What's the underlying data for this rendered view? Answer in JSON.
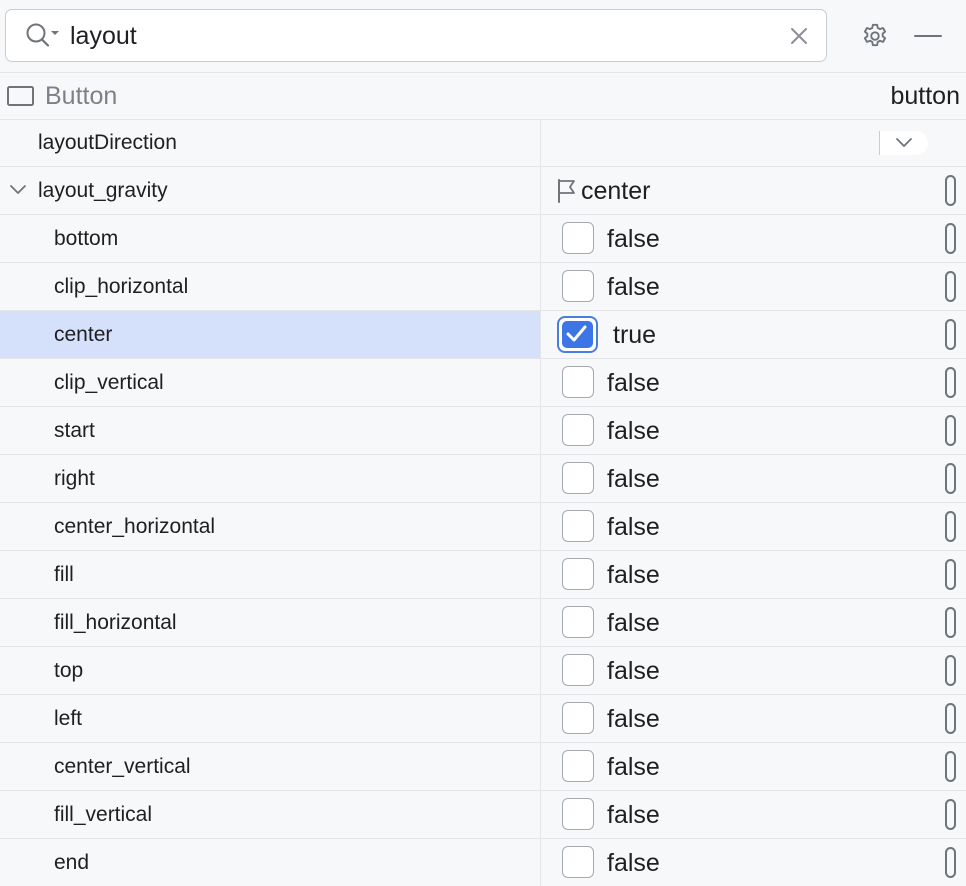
{
  "search": {
    "value": "layout"
  },
  "component": {
    "type_label": "Button",
    "id_label": "button"
  },
  "properties": {
    "layout_direction": {
      "name": "layoutDirection",
      "value": ""
    },
    "layout_gravity": {
      "name": "layout_gravity",
      "value": "center",
      "expanded": true,
      "flags": [
        {
          "name": "bottom",
          "value": "false",
          "checked": false
        },
        {
          "name": "clip_horizontal",
          "value": "false",
          "checked": false
        },
        {
          "name": "center",
          "value": "true",
          "checked": true,
          "selected": true
        },
        {
          "name": "clip_vertical",
          "value": "false",
          "checked": false
        },
        {
          "name": "start",
          "value": "false",
          "checked": false
        },
        {
          "name": "right",
          "value": "false",
          "checked": false
        },
        {
          "name": "center_horizontal",
          "value": "false",
          "checked": false
        },
        {
          "name": "fill",
          "value": "false",
          "checked": false
        },
        {
          "name": "fill_horizontal",
          "value": "false",
          "checked": false
        },
        {
          "name": "top",
          "value": "false",
          "checked": false
        },
        {
          "name": "left",
          "value": "false",
          "checked": false
        },
        {
          "name": "center_vertical",
          "value": "false",
          "checked": false
        },
        {
          "name": "fill_vertical",
          "value": "false",
          "checked": false
        },
        {
          "name": "end",
          "value": "false",
          "checked": false
        }
      ]
    }
  },
  "icons": {
    "search": "search-with-dropdown-icon",
    "clear": "close-icon",
    "settings": "gear-icon",
    "hide": "minimize-icon",
    "component": "button-component-icon",
    "expand": "chevron-down-icon",
    "flag": "flag-icon",
    "dropdown": "chevron-down-icon",
    "attribute_indicator": "pill-handle-icon"
  },
  "colors": {
    "selection": "#d5e1fb",
    "checkbox_checked": "#3d74e6",
    "muted_text": "#7d8089"
  }
}
